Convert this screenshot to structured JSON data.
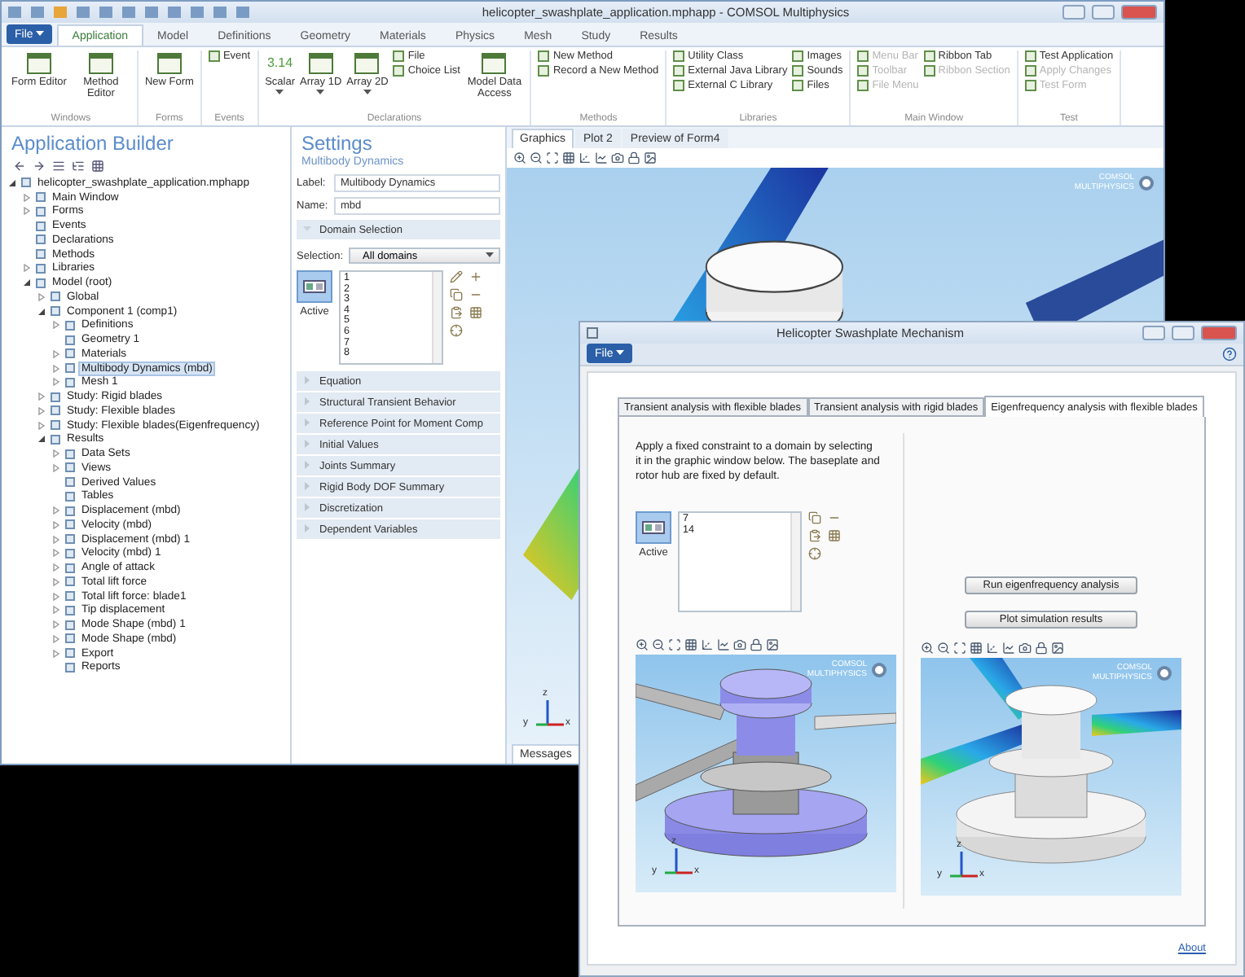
{
  "main_window": {
    "title": "helicopter_swashplate_application.mphapp - COMSOL Multiphysics",
    "file_menu": "File",
    "ribbon_tabs": [
      {
        "label": "Application",
        "selected": true
      },
      {
        "label": "Model",
        "selected": false
      },
      {
        "label": "Definitions",
        "selected": false
      },
      {
        "label": "Geometry",
        "selected": false
      },
      {
        "label": "Materials",
        "selected": false
      },
      {
        "label": "Physics",
        "selected": false
      },
      {
        "label": "Mesh",
        "selected": false
      },
      {
        "label": "Study",
        "selected": false
      },
      {
        "label": "Results",
        "selected": false
      }
    ],
    "ribbon_groups": [
      {
        "label": "Windows",
        "columns": [
          {
            "kind": "large",
            "label": "Form Editor",
            "dropdown": false
          },
          {
            "kind": "large",
            "label": "Method Editor",
            "dropdown": false
          }
        ]
      },
      {
        "label": "Forms",
        "columns": [
          {
            "kind": "large",
            "label": "New Form",
            "dropdown": false
          }
        ]
      },
      {
        "label": "Events",
        "columns": [
          {
            "kind": "stack",
            "items": [
              {
                "label": "Event",
                "disabled": false
              }
            ]
          }
        ]
      },
      {
        "label": "Declarations",
        "columns": [
          {
            "kind": "large",
            "label": "Scalar",
            "icon_text": "3.14",
            "dropdown": true
          },
          {
            "kind": "large",
            "label": "Array 1D",
            "dropdown": true
          },
          {
            "kind": "large",
            "label": "Array 2D",
            "dropdown": true
          },
          {
            "kind": "stack",
            "items": [
              {
                "label": "File",
                "disabled": false
              },
              {
                "label": "Choice List",
                "disabled": false
              }
            ]
          },
          {
            "kind": "large",
            "label": "Model Data Access",
            "dropdown": false
          }
        ]
      },
      {
        "label": "Methods",
        "columns": [
          {
            "kind": "stack",
            "items": [
              {
                "label": "New Method",
                "disabled": false
              },
              {
                "label": "Record a New Method",
                "disabled": false
              }
            ]
          }
        ]
      },
      {
        "label": "Libraries",
        "columns": [
          {
            "kind": "stack",
            "items": [
              {
                "label": "Utility Class",
                "disabled": false
              },
              {
                "label": "External Java Library",
                "disabled": false
              },
              {
                "label": "External C Library",
                "disabled": false
              }
            ]
          },
          {
            "kind": "stack",
            "items": [
              {
                "label": "Images",
                "disabled": false
              },
              {
                "label": "Sounds",
                "disabled": false
              },
              {
                "label": "Files",
                "disabled": false
              }
            ]
          }
        ]
      },
      {
        "label": "Main Window",
        "columns": [
          {
            "kind": "stack",
            "items": [
              {
                "label": "Menu Bar",
                "disabled": true
              },
              {
                "label": "Toolbar",
                "disabled": true
              },
              {
                "label": "File Menu",
                "disabled": true
              }
            ]
          },
          {
            "kind": "stack",
            "items": [
              {
                "label": "Ribbon Tab",
                "disabled": false
              },
              {
                "label": "Ribbon Section",
                "disabled": true
              }
            ]
          }
        ]
      },
      {
        "label": "Test",
        "columns": [
          {
            "kind": "stack",
            "items": [
              {
                "label": "Test Application",
                "disabled": false
              },
              {
                "label": "Apply Changes",
                "disabled": true
              },
              {
                "label": "Test Form",
                "disabled": true
              }
            ]
          }
        ]
      }
    ]
  },
  "app_builder": {
    "title": "Application Builder",
    "tree": [
      {
        "label": "helicopter_swashplate_application.mphapp",
        "expanded": true,
        "selected": false,
        "children": [
          {
            "label": "Main Window",
            "expanded": false,
            "selected": false
          },
          {
            "label": "Forms",
            "expanded": false,
            "selected": false
          },
          {
            "label": "Events",
            "selected": false
          },
          {
            "label": "Declarations",
            "selected": false
          },
          {
            "label": "Methods",
            "selected": false
          },
          {
            "label": "Libraries",
            "expanded": false,
            "selected": false
          },
          {
            "label": "Model (root)",
            "expanded": true,
            "selected": false,
            "children": [
              {
                "label": "Global",
                "expanded": false,
                "selected": false
              },
              {
                "label": "Component 1 (comp1)",
                "expanded": true,
                "selected": false,
                "children": [
                  {
                    "label": "Definitions",
                    "expanded": false,
                    "selected": false
                  },
                  {
                    "label": "Geometry 1",
                    "selected": false
                  },
                  {
                    "label": "Materials",
                    "expanded": false,
                    "selected": false
                  },
                  {
                    "label": "Multibody Dynamics (mbd)",
                    "expanded": false,
                    "selected": true
                  },
                  {
                    "label": "Mesh 1",
                    "expanded": false,
                    "selected": false
                  }
                ]
              },
              {
                "label": "Study: Rigid blades",
                "expanded": false,
                "selected": false
              },
              {
                "label": "Study: Flexible blades",
                "expanded": false,
                "selected": false
              },
              {
                "label": "Study: Flexible blades(Eigenfrequency)",
                "expanded": false,
                "selected": false
              },
              {
                "label": "Results",
                "expanded": true,
                "selected": false,
                "children": [
                  {
                    "label": "Data Sets",
                    "expanded": false,
                    "selected": false
                  },
                  {
                    "label": "Views",
                    "expanded": false,
                    "selected": false
                  },
                  {
                    "label": "Derived Values",
                    "selected": false
                  },
                  {
                    "label": "Tables",
                    "selected": false
                  },
                  {
                    "label": "Displacement (mbd)",
                    "expanded": false,
                    "selected": false
                  },
                  {
                    "label": "Velocity (mbd)",
                    "expanded": false,
                    "selected": false
                  },
                  {
                    "label": "Displacement (mbd) 1",
                    "expanded": false,
                    "selected": false
                  },
                  {
                    "label": "Velocity (mbd) 1",
                    "expanded": false,
                    "selected": false
                  },
                  {
                    "label": "Angle of attack",
                    "expanded": false,
                    "selected": false
                  },
                  {
                    "label": "Total lift force",
                    "expanded": false,
                    "selected": false
                  },
                  {
                    "label": "Total lift force: blade1",
                    "expanded": false,
                    "selected": false
                  },
                  {
                    "label": "Tip displacement",
                    "expanded": false,
                    "selected": false
                  },
                  {
                    "label": "Mode Shape (mbd) 1",
                    "expanded": false,
                    "selected": false
                  },
                  {
                    "label": "Mode Shape (mbd)",
                    "expanded": false,
                    "selected": false
                  },
                  {
                    "label": "Export",
                    "expanded": false,
                    "selected": false
                  },
                  {
                    "label": "Reports",
                    "selected": false
                  }
                ]
              }
            ]
          }
        ]
      }
    ]
  },
  "settings": {
    "title": "Settings",
    "subtitle": "Multibody Dynamics",
    "fields": [
      {
        "label": "Label:",
        "value": "Multibody Dynamics"
      },
      {
        "label": "Name:",
        "value": "mbd"
      }
    ],
    "sections": [
      {
        "label": "Domain Selection",
        "expanded": true,
        "selection": {
          "label": "Selection:",
          "value": "All domains",
          "active_label": "Active",
          "active": true,
          "items": [
            "1",
            "2",
            "3",
            "4",
            "5",
            "6",
            "7",
            "8"
          ]
        }
      },
      {
        "label": "Equation",
        "expanded": false
      },
      {
        "label": "Structural Transient Behavior",
        "expanded": false
      },
      {
        "label": "Reference Point for Moment Comp",
        "expanded": false
      },
      {
        "label": "Initial Values",
        "expanded": false
      },
      {
        "label": "Joints Summary",
        "expanded": false
      },
      {
        "label": "Rigid Body DOF Summary",
        "expanded": false
      },
      {
        "label": "Discretization",
        "expanded": false
      },
      {
        "label": "Dependent Variables",
        "expanded": false
      }
    ]
  },
  "graphics": {
    "tabs": [
      {
        "label": "Graphics",
        "selected": true
      },
      {
        "label": "Plot 2",
        "selected": false
      },
      {
        "label": "Preview of Form4",
        "selected": false
      }
    ],
    "logo_text": "COMSOL MULTIPHYSICS",
    "axes": [
      "z",
      "y",
      "x"
    ],
    "bottom_tabs": [
      {
        "label": "Messages",
        "selected": true
      }
    ]
  },
  "app_window": {
    "title": "Helicopter Swashplate Mechanism",
    "file_menu": "File",
    "tabs": [
      {
        "label": "Transient analysis with flexible blades",
        "selected": false
      },
      {
        "label": "Transient analysis with rigid blades",
        "selected": false
      },
      {
        "label": "Eigenfrequency analysis with flexible blades",
        "selected": true
      }
    ],
    "instructions": "Apply a fixed constraint to a domain by selecting it in the graphic window below. The baseplate and rotor hub are fixed by default.",
    "selection": {
      "active_label": "Active",
      "active": true,
      "items": [
        "7",
        "14"
      ]
    },
    "buttons": [
      "Run eigenfrequency analysis",
      "Plot simulation results"
    ],
    "plots": [
      {
        "kind": "selection",
        "logo_text": "COMSOL MULTIPHYSICS",
        "axes": [
          "z",
          "y",
          "x"
        ]
      },
      {
        "kind": "mode_shape",
        "logo_text": "COMSOL MULTIPHYSICS",
        "axes": [
          "z",
          "y",
          "x"
        ]
      }
    ],
    "link": "About"
  }
}
